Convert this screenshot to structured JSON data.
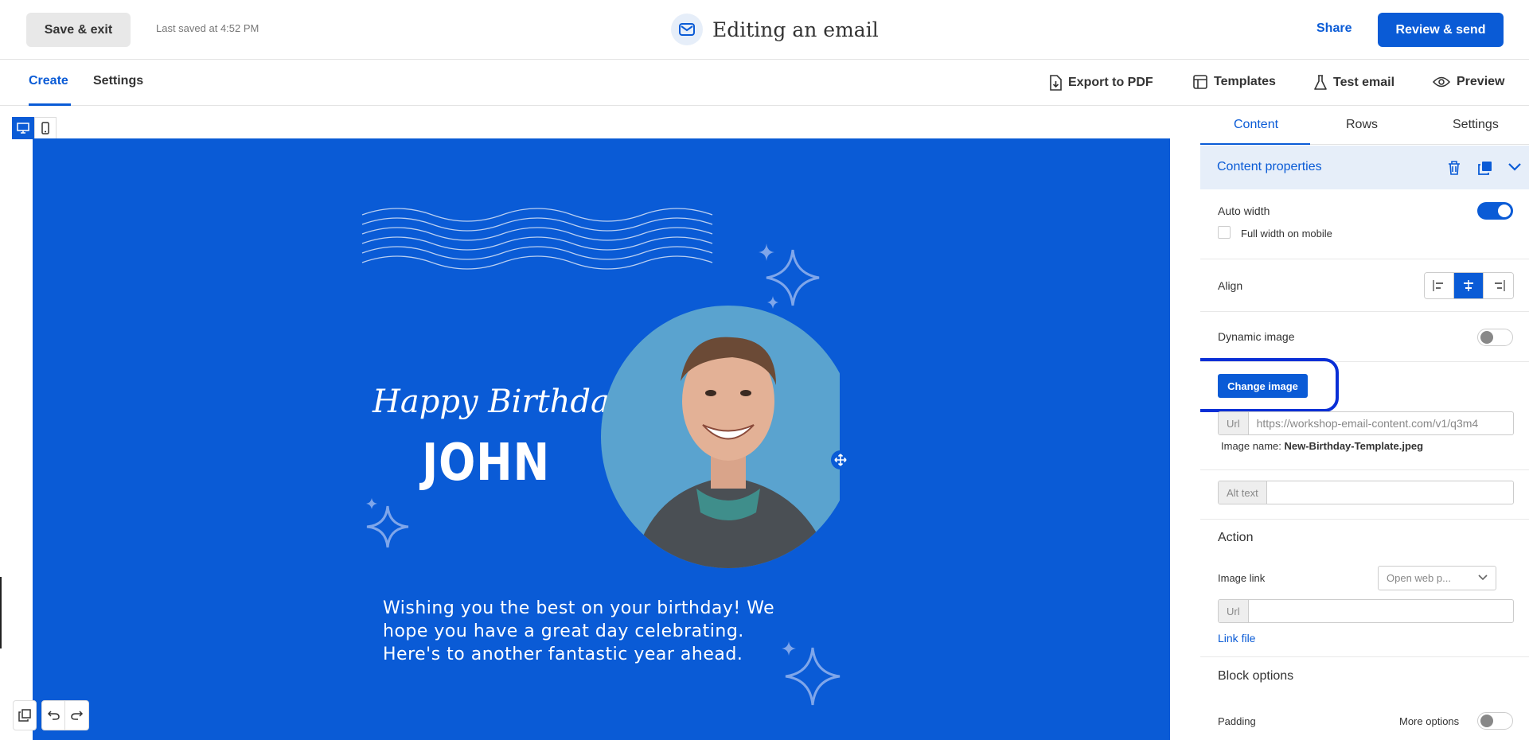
{
  "header": {
    "save_exit": "Save & exit",
    "last_saved": "Last saved at 4:52 PM",
    "title": "Editing an email",
    "share": "Share",
    "review_send": "Review & send"
  },
  "tabs": {
    "create": "Create",
    "settings": "Settings"
  },
  "toolbar": {
    "export_pdf": "Export to PDF",
    "templates": "Templates",
    "test_email": "Test email",
    "preview": "Preview"
  },
  "email": {
    "greeting": "Happy Birthday,",
    "name": "JOHN",
    "message": "Wishing you the best on your birthday! We hope you have a great day celebrating. Here's to another fantastic year ahead.",
    "background_color": "#0a5bd6"
  },
  "panel": {
    "tabs": [
      "Content",
      "Rows",
      "Settings"
    ],
    "content_properties": "Content properties",
    "auto_width": "Auto width",
    "auto_width_on": true,
    "full_width_mobile": "Full width on mobile",
    "align": "Align",
    "dynamic_image": "Dynamic image",
    "change_image": "Change image",
    "url_prefix": "Url",
    "image_url": "https://workshop-email-content.com/v1/q3m4",
    "image_name_label": "Image name:",
    "image_name": "New-Birthday-Template.jpeg",
    "alt_text": "Alt text",
    "action": "Action",
    "image_link": "Image link",
    "image_link_select": "Open web p...",
    "link_url_prefix": "Url",
    "link_file": "Link file",
    "block_options": "Block options",
    "padding": "Padding",
    "more_options": "More options"
  },
  "colors": {
    "accent": "#0a5bd6",
    "highlight": "#0a2fd6"
  }
}
